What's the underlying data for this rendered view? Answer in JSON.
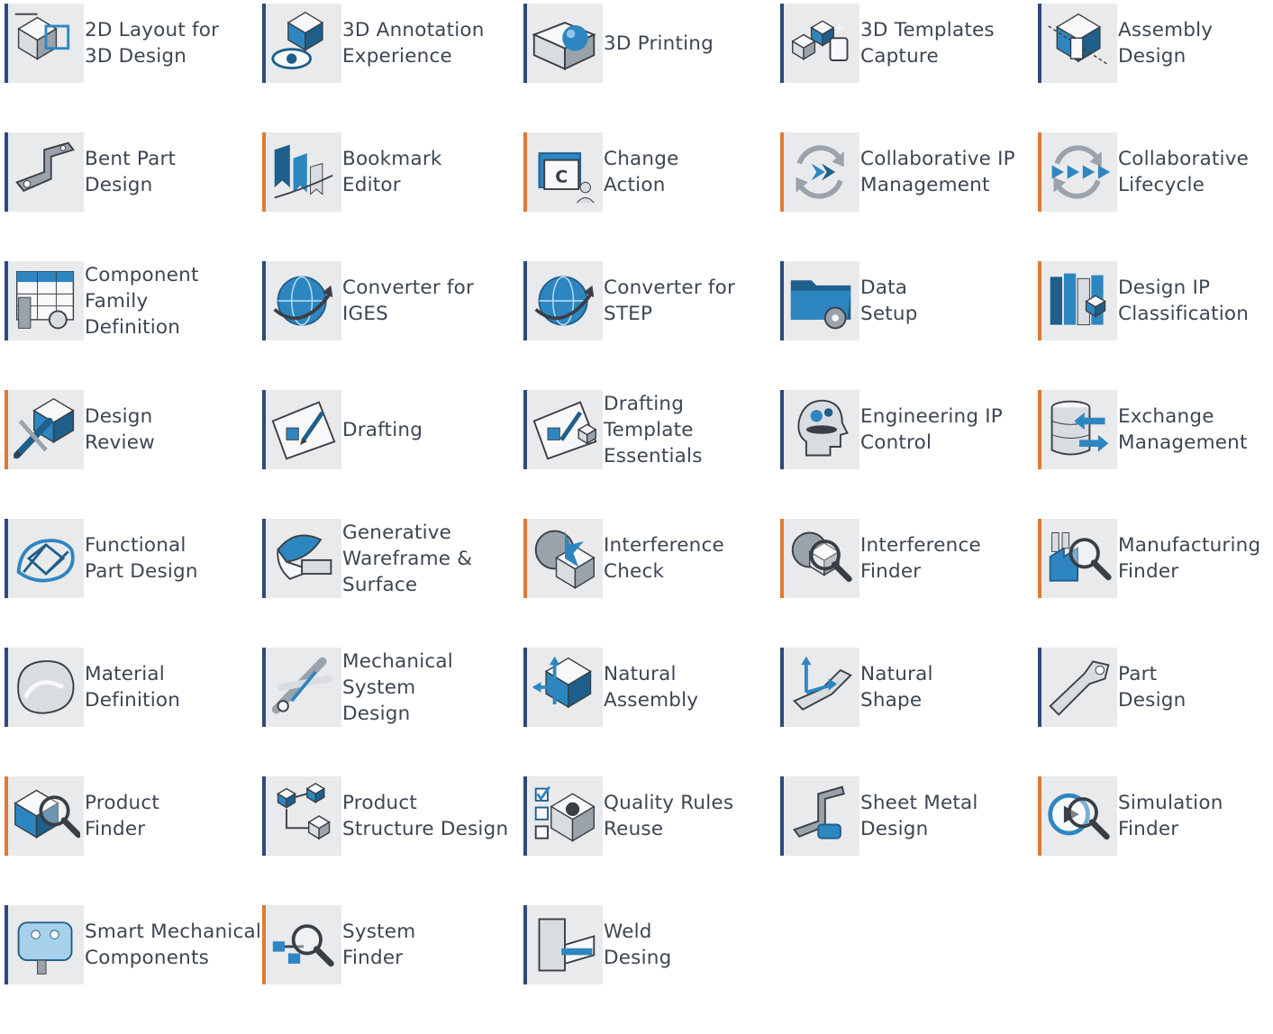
{
  "colors": {
    "accent_blue": "#2e4a7a",
    "accent_orange": "#e07a33",
    "tile_bg": "#e9eaec",
    "icon_blue": "#2e86c1",
    "text": "#3d4652"
  },
  "apps": [
    {
      "label": "2D Layout for\n3D Design",
      "icon": "layout-3d-icon",
      "accent": "blue"
    },
    {
      "label": "3D Annotation\nExperience",
      "icon": "annotation-eye-icon",
      "accent": "blue"
    },
    {
      "label": "3D Printing",
      "icon": "printer-sphere-icon",
      "accent": "blue"
    },
    {
      "label": "3D Templates\nCapture",
      "icon": "template-cubes-icon",
      "accent": "blue"
    },
    {
      "label": "Assembly\nDesign",
      "icon": "assembly-icon",
      "accent": "blue"
    },
    {
      "label": "Bent Part\nDesign",
      "icon": "bent-part-icon",
      "accent": "blue"
    },
    {
      "label": "Bookmark\nEditor",
      "icon": "bookmark-icon",
      "accent": "orange"
    },
    {
      "label": "Change\nAction",
      "icon": "change-action-icon",
      "accent": "orange"
    },
    {
      "label": "Collaborative IP\nManagement",
      "icon": "cycle-arrows-icon",
      "accent": "orange"
    },
    {
      "label": "Collaborative\nLifecycle",
      "icon": "lifecycle-arrows-icon",
      "accent": "orange"
    },
    {
      "label": "Component\nFamily\nDefinition",
      "icon": "component-family-icon",
      "accent": "blue"
    },
    {
      "label": "Converter for\nIGES",
      "icon": "globe-arrow-icon",
      "accent": "blue"
    },
    {
      "label": "Converter for\nSTEP",
      "icon": "globe-arrow-icon",
      "accent": "blue"
    },
    {
      "label": "Data\nSetup",
      "icon": "folder-gear-icon",
      "accent": "blue"
    },
    {
      "label": "Design IP\nClassification",
      "icon": "books-cube-icon",
      "accent": "orange"
    },
    {
      "label": "Design\nReview",
      "icon": "pencil-cube-icon",
      "accent": "orange"
    },
    {
      "label": "Drafting",
      "icon": "drafting-icon",
      "accent": "blue"
    },
    {
      "label": "Drafting\nTemplate\nEssentials",
      "icon": "drafting-template-icon",
      "accent": "blue"
    },
    {
      "label": "Engineering IP\nControl",
      "icon": "head-gears-icon",
      "accent": "blue"
    },
    {
      "label": "Exchange\nManagement",
      "icon": "database-arrows-icon",
      "accent": "orange"
    },
    {
      "label": "Functional\nPart Design",
      "icon": "lattice-part-icon",
      "accent": "blue"
    },
    {
      "label": "Generative\nWareframe &\nSurface",
      "icon": "surface-icon",
      "accent": "blue"
    },
    {
      "label": "Interference\nCheck",
      "icon": "interference-icon",
      "accent": "orange"
    },
    {
      "label": "Interference\nFinder",
      "icon": "interference-magnifier-icon",
      "accent": "orange"
    },
    {
      "label": "Manufacturing\nFinder",
      "icon": "factory-magnifier-icon",
      "accent": "orange"
    },
    {
      "label": "Material\nDefinition",
      "icon": "material-blob-icon",
      "accent": "blue"
    },
    {
      "label": "Mechanical\nSystem\nDesign",
      "icon": "mechanism-icon",
      "accent": "blue"
    },
    {
      "label": "Natural\nAssembly",
      "icon": "natural-assembly-icon",
      "accent": "blue"
    },
    {
      "label": "Natural\nShape",
      "icon": "natural-shape-icon",
      "accent": "blue"
    },
    {
      "label": "Part\nDesign",
      "icon": "part-design-icon",
      "accent": "blue"
    },
    {
      "label": "Product\nFinder",
      "icon": "product-magnifier-icon",
      "accent": "orange"
    },
    {
      "label": "Product\nStructure Design",
      "icon": "structure-tree-icon",
      "accent": "blue"
    },
    {
      "label": "Quality Rules\nReuse",
      "icon": "checklist-icon",
      "accent": "blue"
    },
    {
      "label": "Sheet Metal\nDesign",
      "icon": "sheet-metal-icon",
      "accent": "blue"
    },
    {
      "label": "Simulation\nFinder",
      "icon": "simulation-magnifier-icon",
      "accent": "orange"
    },
    {
      "label": "Smart Mechanical\nComponents",
      "icon": "smart-component-icon",
      "accent": "blue"
    },
    {
      "label": "System\nFinder",
      "icon": "system-magnifier-icon",
      "accent": "orange"
    },
    {
      "label": "Weld\nDesing",
      "icon": "weld-icon",
      "accent": "blue"
    }
  ]
}
